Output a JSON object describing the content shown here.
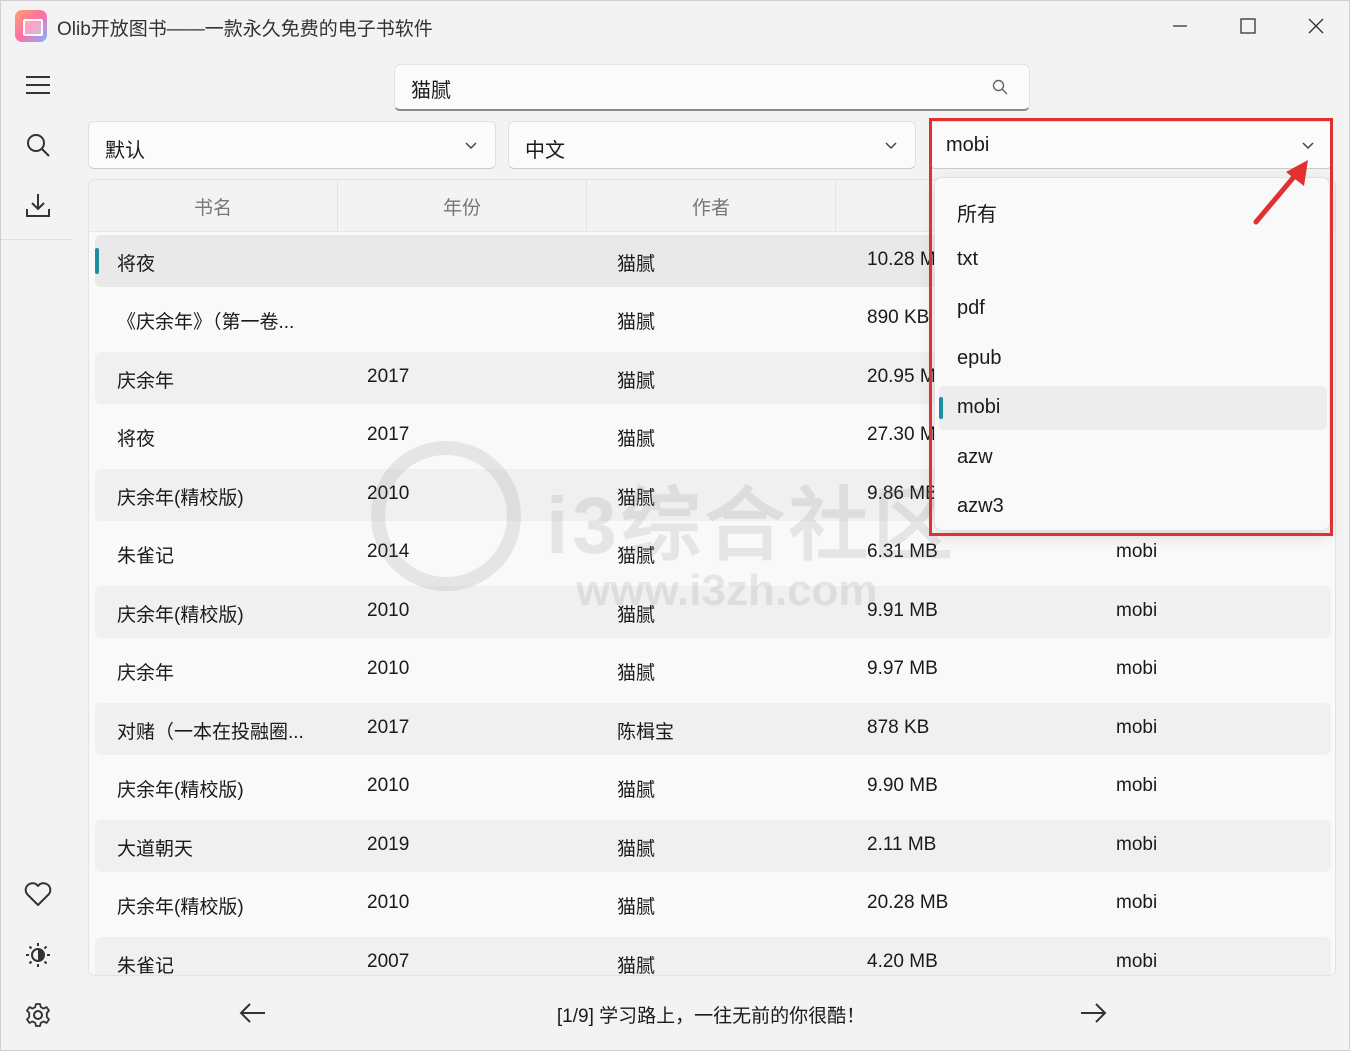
{
  "window": {
    "title": "Olib开放图书——一款永久免费的电子书软件"
  },
  "sidebar": {
    "menu_icon": "hamburger-menu-icon",
    "search_icon": "search-icon",
    "download_icon": "download-icon",
    "favorites_icon": "heart-icon",
    "theme_icon": "brightness-icon",
    "settings_icon": "gear-icon"
  },
  "search": {
    "value": "猫腻",
    "placeholder": ""
  },
  "filters": {
    "sort": "默认",
    "language": "中文",
    "format": "mobi"
  },
  "table": {
    "columns": [
      "书名",
      "年份",
      "作者",
      "",
      ""
    ],
    "rows": [
      {
        "title": "将夜",
        "year": "",
        "author": "猫腻",
        "size": "10.28 M",
        "format": ""
      },
      {
        "title": "《庆余年》（第一卷...",
        "year": "",
        "author": "猫腻",
        "size": "890 KB",
        "format": ""
      },
      {
        "title": "庆余年",
        "year": "2017",
        "author": "猫腻",
        "size": "20.95 M",
        "format": ""
      },
      {
        "title": "将夜",
        "year": "2017",
        "author": "猫腻",
        "size": "27.30 M",
        "format": ""
      },
      {
        "title": "庆余年(精校版)",
        "year": "2010",
        "author": "猫腻",
        "size": "9.86 MB",
        "format": ""
      },
      {
        "title": "朱雀记",
        "year": "2014",
        "author": "猫腻",
        "size": "6.31 MB",
        "format": "mobi"
      },
      {
        "title": "庆余年(精校版)",
        "year": "2010",
        "author": "猫腻",
        "size": "9.91 MB",
        "format": "mobi"
      },
      {
        "title": "庆余年",
        "year": "2010",
        "author": "猫腻",
        "size": "9.97 MB",
        "format": "mobi"
      },
      {
        "title": "对赌（一本在投融圈...",
        "year": "2017",
        "author": "陈楫宝",
        "size": "878 KB",
        "format": "mobi"
      },
      {
        "title": "庆余年(精校版)",
        "year": "2010",
        "author": "猫腻",
        "size": "9.90 MB",
        "format": "mobi"
      },
      {
        "title": "大道朝天",
        "year": "2019",
        "author": "猫腻",
        "size": "2.11 MB",
        "format": "mobi"
      },
      {
        "title": "庆余年(精校版)",
        "year": "2010",
        "author": "猫腻",
        "size": "20.28 MB",
        "format": "mobi"
      },
      {
        "title": "朱雀记",
        "year": "2007",
        "author": "猫腻",
        "size": "4.20 MB",
        "format": "mobi"
      }
    ]
  },
  "format_menu": {
    "options": [
      "所有",
      "txt",
      "pdf",
      "epub",
      "mobi",
      "azw",
      "azw3"
    ],
    "selected": "mobi"
  },
  "watermark": {
    "text": "i3综合社区",
    "url": "www.i3zh.com"
  },
  "footer": {
    "status": "[1/9] 学习路上，一往无前的你很酷！",
    "prev_icon": "arrow-left-icon",
    "next_icon": "arrow-right-icon"
  },
  "colors": {
    "accent": "#1e8e9e",
    "highlight": "#e03030"
  }
}
